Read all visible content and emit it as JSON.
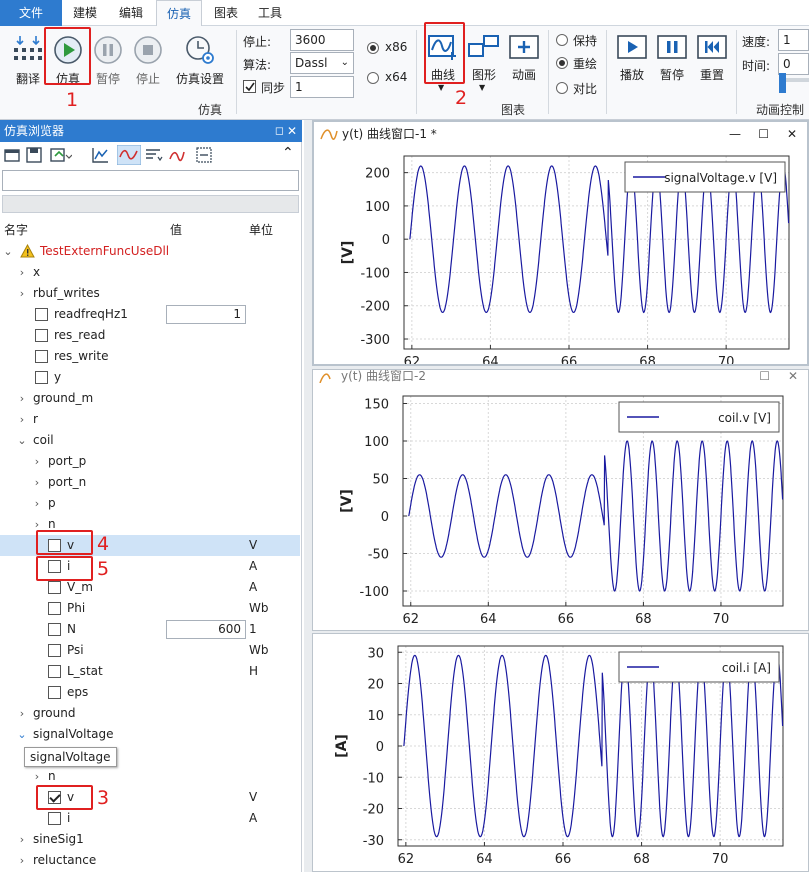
{
  "menu": {
    "file": "文件",
    "items": [
      "建模",
      "编辑",
      "仿真",
      "图表",
      "工具"
    ]
  },
  "ribbon": {
    "translate": "翻译",
    "simulate": "仿真",
    "pause": "暂停",
    "stop": "停止",
    "sim_settings": "仿真设置",
    "stop_label": "停止:",
    "stop_value": "3600",
    "algo_label": "算法:",
    "algo_value": "Dassl",
    "sync_label": "同步",
    "sync_value": "1",
    "x86": "x86",
    "x64": "x64",
    "group_sim": "仿真",
    "curve": "曲线",
    "figure": "图形",
    "animation": "动画",
    "group_chart": "图表",
    "keep": "保持",
    "overlay": "重绘",
    "compare": "对比",
    "play": "播放",
    "pause2": "暂停",
    "reset": "重置",
    "speed_label": "速度:",
    "speed_value": "1",
    "time_label": "时间:",
    "time_value": "0",
    "group_anim": "动画控制"
  },
  "annotations": [
    "1",
    "2",
    "3",
    "4",
    "5"
  ],
  "browser": {
    "title": "仿真浏览器",
    "col_name": "名字",
    "col_value": "值",
    "col_unit": "单位",
    "root": "TestExternFuncUseDll",
    "rows": [
      {
        "label": "x",
        "value": "",
        "unit": ""
      },
      {
        "label": "rbuf_writes",
        "value": "",
        "unit": ""
      },
      {
        "label": "readfreqHz1",
        "value": "1",
        "unit": ""
      },
      {
        "label": "res_read",
        "value": "",
        "unit": ""
      },
      {
        "label": "res_write",
        "value": "",
        "unit": ""
      },
      {
        "label": "y",
        "value": "",
        "unit": ""
      },
      {
        "label": "ground_m",
        "value": "",
        "unit": ""
      },
      {
        "label": "r",
        "value": "",
        "unit": ""
      },
      {
        "label": "coil",
        "value": "",
        "unit": ""
      },
      {
        "label": "port_p",
        "value": "",
        "unit": ""
      },
      {
        "label": "port_n",
        "value": "",
        "unit": ""
      },
      {
        "label": "p",
        "value": "",
        "unit": ""
      },
      {
        "label": "n",
        "value": "",
        "unit": ""
      },
      {
        "label": "v",
        "value": "",
        "unit": "V"
      },
      {
        "label": "i",
        "value": "",
        "unit": "A"
      },
      {
        "label": "V_m",
        "value": "",
        "unit": "A"
      },
      {
        "label": "Phi",
        "value": "",
        "unit": "Wb"
      },
      {
        "label": "N",
        "value": "600",
        "unit": "1"
      },
      {
        "label": "Psi",
        "value": "",
        "unit": "Wb"
      },
      {
        "label": "L_stat",
        "value": "",
        "unit": "H"
      },
      {
        "label": "eps",
        "value": "",
        "unit": ""
      },
      {
        "label": "ground",
        "value": "",
        "unit": ""
      },
      {
        "label": "signalVoltage",
        "value": "",
        "unit": ""
      },
      {
        "label": "n",
        "value": "",
        "unit": ""
      },
      {
        "label": "v",
        "value": "",
        "unit": "V"
      },
      {
        "label": "i",
        "value": "",
        "unit": "A"
      },
      {
        "label": "sineSig1",
        "value": "",
        "unit": ""
      },
      {
        "label": "reluctance",
        "value": "",
        "unit": ""
      }
    ],
    "tooltip": "signalVoltage"
  },
  "windows": [
    {
      "title": "y(t) 曲线窗口-1 *"
    },
    {
      "title": "y(t) 曲线窗口-2"
    }
  ],
  "chart_data": [
    {
      "type": "line",
      "title": "",
      "ylabel": "[V]",
      "xlabel": "",
      "xlim": [
        61.8,
        71.6
      ],
      "ylim": [
        -330,
        250
      ],
      "xticks": [
        62,
        64,
        66,
        68,
        70
      ],
      "yticks": [
        -300,
        -200,
        -100,
        0,
        100,
        200
      ],
      "series": [
        {
          "name": "signalVoltage.v [V]",
          "amplitude": 220,
          "freq1": 0.9,
          "freq2": 1.55,
          "switch_x": 67.0,
          "color": "#1a1aa0"
        }
      ]
    },
    {
      "type": "line",
      "title": "",
      "ylabel": "[V]",
      "xlabel": "",
      "xlim": [
        61.8,
        71.6
      ],
      "ylim": [
        -120,
        160
      ],
      "xticks": [
        62,
        64,
        66,
        68,
        70
      ],
      "yticks": [
        -100,
        -50,
        0,
        50,
        100,
        150
      ],
      "series": [
        {
          "name": "coil.v [V]",
          "amplitude1": 55,
          "amplitude2": 100,
          "freq1": 0.9,
          "freq2": 1.55,
          "switch_x": 67.0,
          "color": "#1a1aa0"
        }
      ]
    },
    {
      "type": "line",
      "title": "",
      "ylabel": "[A]",
      "xlabel": "",
      "xlim": [
        61.8,
        71.6
      ],
      "ylim": [
        -32,
        32
      ],
      "xticks": [
        62,
        64,
        66,
        68,
        70
      ],
      "yticks": [
        -30,
        -20,
        -10,
        0,
        10,
        20,
        30
      ],
      "series": [
        {
          "name": "coil.i [A]",
          "amplitude": 29,
          "freq1": 0.9,
          "freq2": 1.55,
          "switch_x": 67.0,
          "color": "#1a1aa0"
        }
      ]
    }
  ]
}
